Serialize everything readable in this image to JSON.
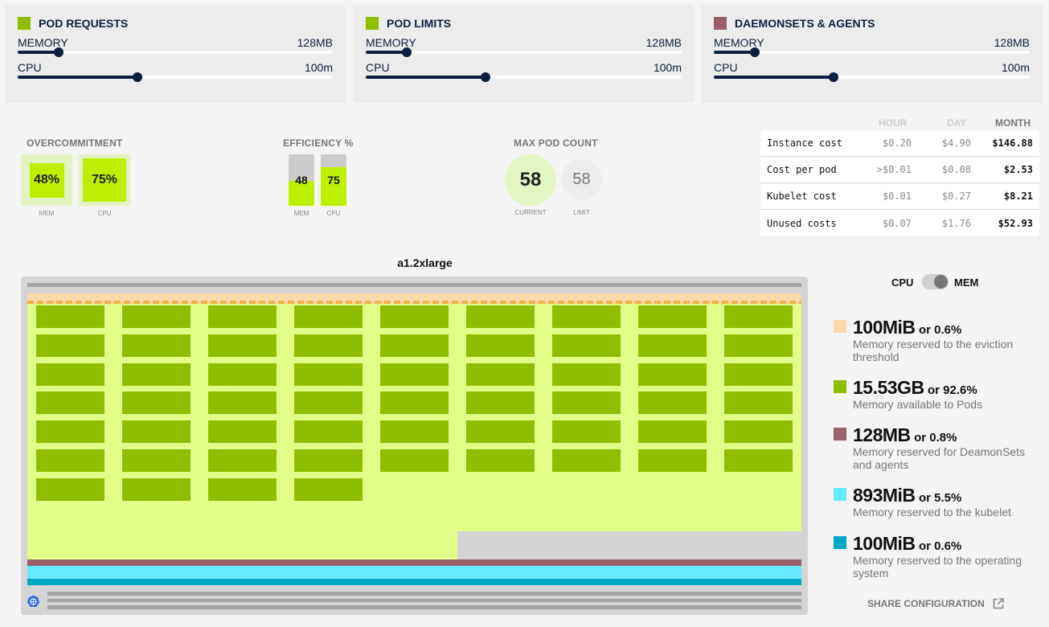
{
  "panels": [
    {
      "title": "POD REQUESTS",
      "color": "#8fbd00",
      "memory_label": "MEMORY",
      "memory_value": "128MB",
      "memory_fraction": 0.13,
      "cpu_label": "CPU",
      "cpu_value": "100m",
      "cpu_fraction": 0.38
    },
    {
      "title": "POD LIMITS",
      "color": "#8fbd00",
      "memory_label": "MEMORY",
      "memory_value": "128MB",
      "memory_fraction": 0.13,
      "cpu_label": "CPU",
      "cpu_value": "100m",
      "cpu_fraction": 0.38
    },
    {
      "title": "DAEMONSETS & AGENTS",
      "color": "#9b5f6b",
      "memory_label": "MEMORY",
      "memory_value": "128MB",
      "memory_fraction": 0.13,
      "cpu_label": "CPU",
      "cpu_value": "100m",
      "cpu_fraction": 0.38
    }
  ],
  "overcommitment": {
    "title": "OVERCOMMITMENT",
    "mem": {
      "value": "48%",
      "label": "MEM",
      "fraction": 0.48
    },
    "cpu": {
      "value": "75%",
      "label": "CPU",
      "fraction": 0.75
    }
  },
  "efficiency": {
    "title": "EFFICIENCY %",
    "mem": {
      "value": "48",
      "label": "MEM",
      "fraction": 0.48
    },
    "cpu": {
      "value": "75",
      "label": "CPU",
      "fraction": 0.75
    }
  },
  "max_pod_count": {
    "title": "MAX POD COUNT",
    "current": {
      "value": "58",
      "label": "CURRENT"
    },
    "limit": {
      "value": "58",
      "label": "LIMIT"
    }
  },
  "costs": {
    "headers": [
      "HOUR",
      "DAY",
      "MONTH"
    ],
    "rows": [
      {
        "name": "Instance cost",
        "hour": "$0.20",
        "day": "$4.90",
        "month": "$146.88"
      },
      {
        "name": "Cost per pod",
        "hour": ">$0.01",
        "day": "$0.08",
        "month": "$2.53"
      },
      {
        "name": "Kubelet cost",
        "hour": "$0.01",
        "day": "$0.27",
        "month": "$8.21"
      },
      {
        "name": "Unused costs",
        "hour": "$0.07",
        "day": "$1.76",
        "month": "$52.93"
      }
    ]
  },
  "node": {
    "instance_type": "a1.2xlarge",
    "pod_count": 58,
    "pods_per_row": 9,
    "colors": {
      "eviction": "#fcd9a8",
      "eviction_dash": "#f5b04a",
      "pods_area": "#e2fe88",
      "pod": "#8fbd00",
      "unused": "#d4d4d4",
      "daemonsets": "#9b5f6b",
      "kubelet": "#66e8ff",
      "os": "#00a8c6"
    }
  },
  "toggle": {
    "left_label": "CPU",
    "right_label": "MEM",
    "selected": "MEM"
  },
  "legend": [
    {
      "value": "100MiB",
      "percent": "or 0.6%",
      "desc": "Memory reserved to the eviction threshold",
      "color": "#fcd9a8"
    },
    {
      "value": "15.53GB",
      "percent": "or 92.6%",
      "desc": "Memory available to Pods",
      "color": "#8fbd00"
    },
    {
      "value": "128MB",
      "percent": "or 0.8%",
      "desc": "Memory reserved for DeamonSets and agents",
      "color": "#9b5f6b"
    },
    {
      "value": "893MiB",
      "percent": "or 5.5%",
      "desc": "Memory reserved to the kubelet",
      "color": "#66e8ff"
    },
    {
      "value": "100MiB",
      "percent": "or 0.6%",
      "desc": "Memory reserved to the operating system",
      "color": "#00a8c6"
    }
  ],
  "share": {
    "label": "SHARE CONFIGURATION"
  }
}
